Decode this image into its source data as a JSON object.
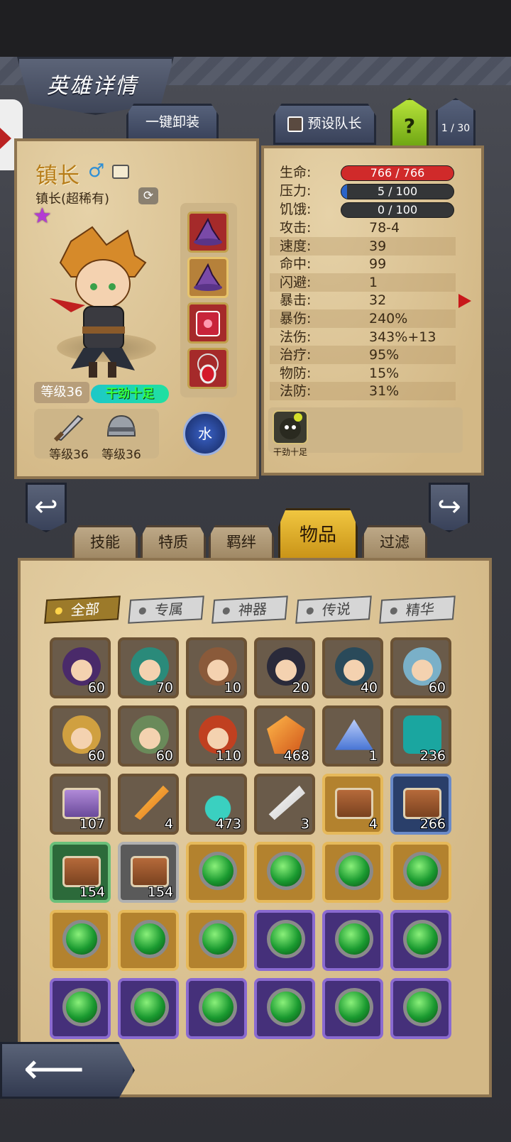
{
  "header": {
    "title": "英雄详情"
  },
  "top_buttons": {
    "unload_all": "一键卸装",
    "preset_captain": "预设队长",
    "help": "?",
    "page_count": "1 / 30"
  },
  "hero": {
    "name": "镇长",
    "gender_icon": "male-icon",
    "class_rarity": "镇长(超稀有)",
    "stars": 1,
    "level_label": "等级36",
    "trait_tag": "干劲十足",
    "element": "水",
    "equipment": [
      {
        "icon": "purple-hat-icon",
        "frame": "red"
      },
      {
        "icon": "purple-hat-icon",
        "frame": "gold"
      },
      {
        "icon": "red-book-icon",
        "frame": "red"
      },
      {
        "icon": "ruby-amulet-icon",
        "frame": "red"
      }
    ],
    "weapon": {
      "icon": "sword-icon",
      "level_label": "等级36"
    },
    "armor": {
      "icon": "helmet-icon",
      "level_label": "等级36"
    }
  },
  "stats": {
    "hp": {
      "label": "生命:",
      "value": "766 / 766",
      "fill": 1.0,
      "color": "#d02a2a"
    },
    "stress": {
      "label": "压力:",
      "value": "5 / 100",
      "fill": 0.05,
      "color": "#2a64c8"
    },
    "hunger": {
      "label": "饥饿:",
      "value": "0 / 100",
      "fill": 0.0,
      "color": "#d07a20"
    },
    "rows": [
      {
        "label": "攻击:",
        "value": "78-4"
      },
      {
        "label": "速度:",
        "value": "39"
      },
      {
        "label": "命中:",
        "value": "99"
      },
      {
        "label": "闪避:",
        "value": "1"
      },
      {
        "label": "暴击:",
        "value": "32"
      },
      {
        "label": "暴伤:",
        "value": "240%"
      },
      {
        "label": "法伤:",
        "value": "343%+13"
      },
      {
        "label": "治疗:",
        "value": "95%"
      },
      {
        "label": "物防:",
        "value": "15%"
      },
      {
        "label": "法防:",
        "value": "31%"
      }
    ],
    "trait_icon_label": "干劲十足"
  },
  "tabs": [
    "技能",
    "特质",
    "羁绊",
    "物品",
    "过滤"
  ],
  "active_tab": "物品",
  "filters": [
    "全部",
    "专属",
    "神器",
    "传说",
    "精华"
  ],
  "active_filter": "全部",
  "inventory": [
    {
      "icon": "hero-portrait-icon",
      "count": "60",
      "frame": "brown"
    },
    {
      "icon": "hero-portrait-icon",
      "count": "70",
      "frame": "brown"
    },
    {
      "icon": "hero-portrait-icon",
      "count": "10",
      "frame": "brown"
    },
    {
      "icon": "hero-portrait-icon",
      "count": "20",
      "frame": "brown"
    },
    {
      "icon": "hero-portrait-icon",
      "count": "40",
      "frame": "brown"
    },
    {
      "icon": "hero-portrait-icon",
      "count": "60",
      "frame": "brown"
    },
    {
      "icon": "hero-portrait-icon",
      "count": "60",
      "frame": "brown"
    },
    {
      "icon": "hero-portrait-icon",
      "count": "60",
      "frame": "brown"
    },
    {
      "icon": "hero-portrait-icon",
      "count": "110",
      "frame": "brown"
    },
    {
      "icon": "amber-gem-icon",
      "count": "468",
      "frame": "brown"
    },
    {
      "icon": "crystal-dust-icon",
      "count": "1",
      "frame": "brown"
    },
    {
      "icon": "rune-stone-icon",
      "count": "236",
      "frame": "brown"
    },
    {
      "icon": "purple-chest-icon",
      "count": "107",
      "frame": "brown"
    },
    {
      "icon": "phoenix-feather-icon",
      "count": "4",
      "frame": "brown"
    },
    {
      "icon": "potion-icon",
      "count": "473",
      "frame": "brown"
    },
    {
      "icon": "white-feather-icon",
      "count": "3",
      "frame": "brown"
    },
    {
      "icon": "chest-icon",
      "count": "4",
      "frame": "gold"
    },
    {
      "icon": "chest-icon",
      "count": "266",
      "frame": "blue"
    },
    {
      "icon": "chest-icon",
      "count": "154",
      "frame": "green"
    },
    {
      "icon": "chest-icon",
      "count": "154",
      "frame": "silver"
    },
    {
      "icon": "green-gem-icon",
      "count": "",
      "frame": "gold"
    },
    {
      "icon": "green-gem-icon",
      "count": "",
      "frame": "gold"
    },
    {
      "icon": "green-gem-icon",
      "count": "",
      "frame": "gold"
    },
    {
      "icon": "green-gem-icon",
      "count": "",
      "frame": "gold"
    },
    {
      "icon": "green-gem-icon",
      "count": "",
      "frame": "gold"
    },
    {
      "icon": "green-gem-icon",
      "count": "",
      "frame": "gold"
    },
    {
      "icon": "green-gem-icon",
      "count": "",
      "frame": "gold"
    },
    {
      "icon": "green-gem-icon",
      "count": "",
      "frame": "purple"
    },
    {
      "icon": "green-gem-icon",
      "count": "",
      "frame": "purple"
    },
    {
      "icon": "green-gem-icon",
      "count": "",
      "frame": "purple"
    },
    {
      "icon": "green-gem-icon",
      "count": "",
      "frame": "purple"
    },
    {
      "icon": "green-gem-icon",
      "count": "",
      "frame": "purple"
    },
    {
      "icon": "green-gem-icon",
      "count": "",
      "frame": "purple"
    },
    {
      "icon": "green-gem-icon",
      "count": "",
      "frame": "purple"
    },
    {
      "icon": "green-gem-icon",
      "count": "",
      "frame": "purple"
    },
    {
      "icon": "green-gem-icon",
      "count": "",
      "frame": "purple"
    }
  ]
}
